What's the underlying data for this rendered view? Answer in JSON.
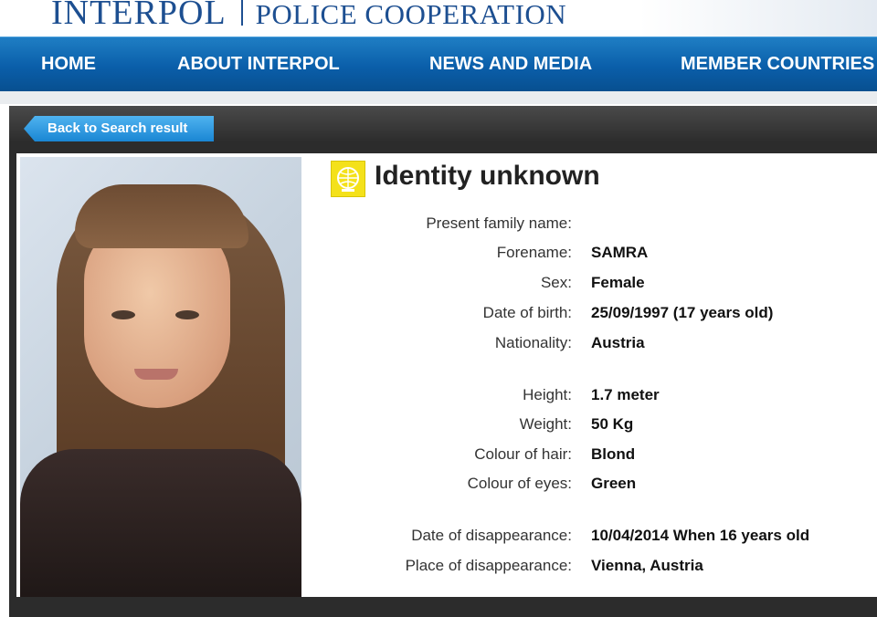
{
  "header": {
    "brand": "INTERPOL",
    "tagline": "POLICE COOPERATION"
  },
  "nav": {
    "items": [
      {
        "label": "HOME"
      },
      {
        "label": "ABOUT INTERPOL"
      },
      {
        "label": "NEWS AND MEDIA"
      },
      {
        "label": "MEMBER COUNTRIES"
      }
    ]
  },
  "back_button": {
    "label": "Back to Search result"
  },
  "notice": {
    "logo_icon": "interpol-emblem-icon",
    "logo_color": "#f4e11a",
    "title": "Identity unknown",
    "fields": [
      {
        "label": "Present family name:",
        "value": ""
      },
      {
        "label": "Forename:",
        "value": "SAMRA"
      },
      {
        "label": "Sex:",
        "value": "Female"
      },
      {
        "label": "Date of birth:",
        "value": "25/09/1997 (17 years old)"
      },
      {
        "label": "Nationality:",
        "value": "Austria"
      },
      {
        "label": "Height:",
        "value": "1.7 meter"
      },
      {
        "label": "Weight:",
        "value": "50 Kg"
      },
      {
        "label": "Colour of hair:",
        "value": "Blond"
      },
      {
        "label": "Colour of eyes:",
        "value": "Green"
      },
      {
        "label": "Date of disappearance:",
        "value": "10/04/2014 When 16 years old"
      },
      {
        "label": "Place of disappearance:",
        "value": "Vienna, Austria"
      }
    ]
  },
  "colors": {
    "nav_blue": "#0a5ea9",
    "brand_blue": "#1d4f91",
    "button_blue": "#1a86d3"
  }
}
